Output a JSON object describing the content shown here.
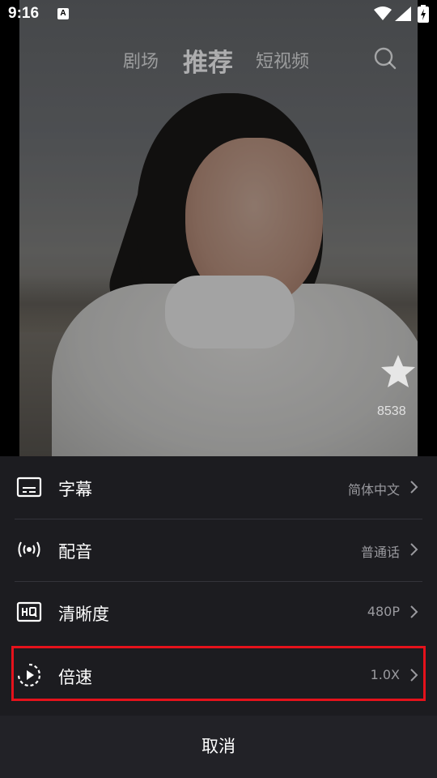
{
  "status_bar": {
    "time": "9:16",
    "notification_letter": "A"
  },
  "top_nav": {
    "tabs": [
      {
        "label": "剧场",
        "active": false
      },
      {
        "label": "推荐",
        "active": true
      },
      {
        "label": "短视频",
        "active": false
      }
    ]
  },
  "video": {
    "like_count": "8538"
  },
  "settings_sheet": {
    "rows": [
      {
        "label": "字幕",
        "value": "简体中文",
        "icon": "subtitles-icon"
      },
      {
        "label": "配音",
        "value": "普通话",
        "icon": "audio-broadcast-icon"
      },
      {
        "label": "清晰度",
        "value": "480P",
        "icon": "hq-icon"
      },
      {
        "label": "倍速",
        "value": "1.0X",
        "icon": "playback-speed-icon"
      }
    ],
    "cancel_label": "取消"
  },
  "colors": {
    "sheet_background": "#1c1c20",
    "highlight_border": "#e5121b",
    "value_text": "#9a9a9f"
  }
}
